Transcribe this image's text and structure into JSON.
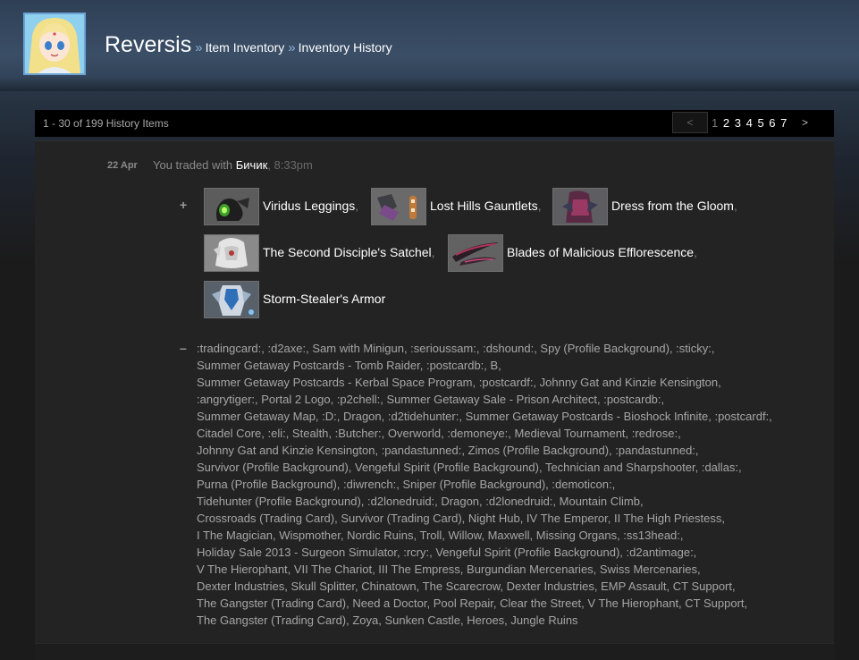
{
  "header": {
    "username": "Reversis",
    "breadcrumb_sep": "»",
    "breadcrumbs": [
      "Item Inventory",
      "Inventory History"
    ]
  },
  "paging": {
    "summary": "1 - 30 of 199 History Items",
    "prev": "<",
    "next": ">",
    "pages": [
      "1",
      "2",
      "3",
      "4",
      "5",
      "6",
      "7"
    ],
    "current": "1"
  },
  "trade": {
    "date": "22 Apr",
    "text": "You traded with",
    "partner": "Бичик",
    "time": ", 8:33pm",
    "plus": "+",
    "minus": "–",
    "received_items": [
      {
        "name": "Viridus Leggings",
        "sep": ","
      },
      {
        "name": "Lost Hills Gauntlets",
        "sep": ","
      },
      {
        "name": "Dress from the Gloom",
        "sep": ","
      },
      {
        "name": "The Second Disciple's Satchel",
        "sep": ","
      },
      {
        "name": "Blades of Malicious Efflorescence",
        "sep": ","
      },
      {
        "name": "Storm-Stealer's Armor",
        "sep": ""
      }
    ],
    "given_lines": [
      ":tradingcard:, :d2axe:, Sam with Minigun, :serioussam:, :dshound:, Spy (Profile Background), :sticky:,",
      "Summer Getaway Postcards - Tomb Raider, :postcardb:, B,",
      "Summer Getaway Postcards - Kerbal Space Program, :postcardf:, Johnny Gat and Kinzie Kensington,",
      ":angrytiger:, Portal 2 Logo, :p2chell:, Summer Getaway Sale - Prison Architect, :postcardb:,",
      "Summer Getaway Map, :D:, Dragon, :d2tidehunter:, Summer Getaway Postcards - Bioshock Infinite, :postcardf:,",
      "Citadel Core, :eli:, Stealth, :Butcher:, Overworld, :demoneye:, Medieval Tournament, :redrose:,",
      "Johnny Gat and Kinzie Kensington, :pandastunned:, Zimos (Profile Background), :pandastunned:,",
      "Survivor (Profile Background), Vengeful Spirit (Profile Background), Technician and Sharpshooter, :dallas:,",
      "Purna (Profile Background), :diwrench:, Sniper (Profile Background), :demoticon:,",
      "Tidehunter (Profile Background), :d2lonedruid:, Dragon, :d2lonedruid:, Mountain Climb,",
      "Crossroads (Trading Card), Survivor (Trading Card), Night Hub, IV The Emperor, II The High Priestess,",
      "I The Magician, Wispmother, Nordic Ruins, Troll, Willow, Maxwell, Missing Organs, :ss13head:,",
      "Holiday Sale 2013 - Surgeon Simulator, :rcry:, Vengeful Spirit (Profile Background), :d2antimage:,",
      "V The Hierophant, VII The Chariot, III The Empress, Burgundian Mercenaries, Swiss Mercenaries,",
      "Dexter Industries, Skull Splitter, Chinatown, The Scarecrow, Dexter Industries, EMP Assault, CT Support,",
      "The Gangster (Trading Card), Need a Doctor, Pool Repair, Clear the Street, V The Hierophant, CT Support,",
      "The Gangster (Trading Card), Zoya, Sunken Castle, Heroes, Jungle Ruins"
    ]
  }
}
